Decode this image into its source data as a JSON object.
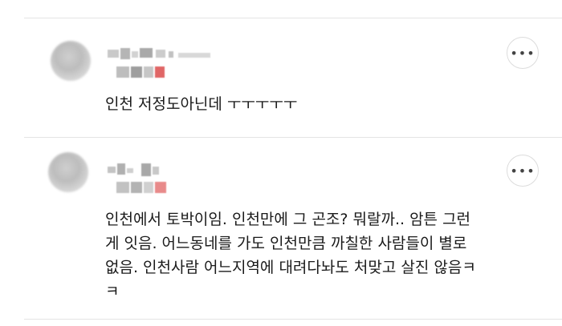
{
  "comments": [
    {
      "text": "인천 저정도아닌데 ㅜㅜㅜㅜㅜ",
      "more_label": "•••"
    },
    {
      "text": "인천에서 토박이임. 인천만에 그 곤조? 뭐랄까.. 암튼 그런\n게 잇음. 어느동네를 가도 인천만큼 까칠한 사람들이 별로\n없음. 인천사람 어느지역에 대려다놔도 처맞고 살진 않음ㅋ\nㅋ",
      "more_label": "•••"
    }
  ],
  "colors": {
    "divider": "#e4e4e4",
    "mosaic_gray": "#bdbdbd",
    "mosaic_red": "#e06666"
  }
}
